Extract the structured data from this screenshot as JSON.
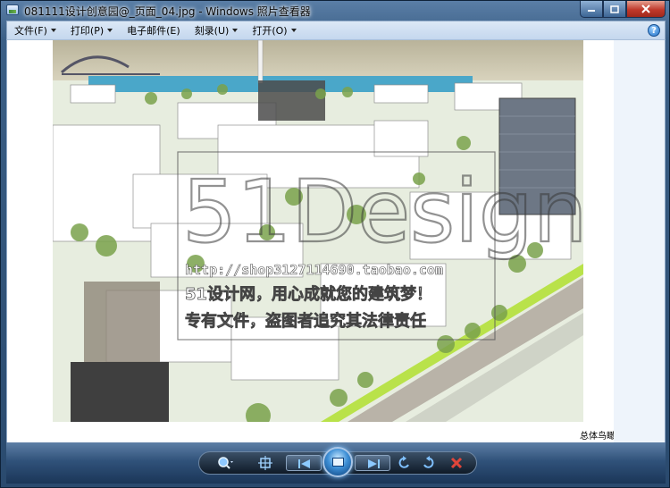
{
  "window": {
    "title": "081111设计创意园@_页面_04.jpg - Windows 照片查看器"
  },
  "menu": {
    "items": [
      {
        "label": "文件(F)"
      },
      {
        "label": "打印(P)"
      },
      {
        "label": "电子邮件(E)"
      },
      {
        "label": "刻录(U)"
      },
      {
        "label": "打开(O)"
      }
    ],
    "help_label": "?"
  },
  "image": {
    "watermark_logo": "51Design",
    "watermark_url": "http://shop3127114690.taobao.com",
    "watermark_slogan": "51设计网，用心成就您的建筑梦！",
    "watermark_notice": "专有文件，盗图者追究其法律责任",
    "caption": "总体鸟瞰"
  },
  "controls": {
    "zoom_icon": "magnifier-icon",
    "fit_icon": "actual-size-icon",
    "prev_icon": "previous-icon",
    "slideshow_icon": "slideshow-icon",
    "next_icon": "next-icon",
    "rotate_ccw_icon": "rotate-counterclockwise-icon",
    "rotate_cw_icon": "rotate-clockwise-icon",
    "delete_icon": "delete-icon"
  },
  "colors": {
    "accent": "#1e6fc7",
    "close": "#c0392b",
    "delete": "#d9382c"
  }
}
